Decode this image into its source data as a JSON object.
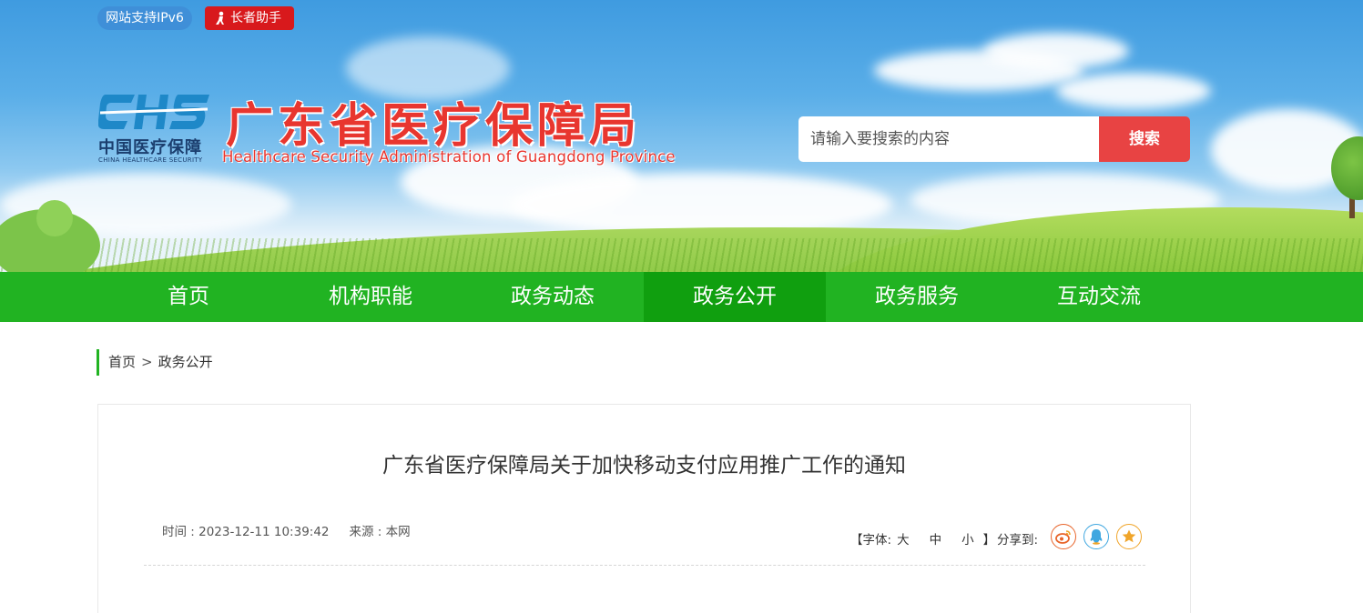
{
  "top_bar": {
    "ipv6_label": "网站支持IPv6",
    "elder_label": "长者助手"
  },
  "logo": {
    "mark_text": "CHS",
    "cn_text": "中国医疗保障",
    "en_text": "CHINA HEALTHCARE SECURITY"
  },
  "header": {
    "title": "广东省医疗保障局",
    "subtitle": "Healthcare Security Administration of Guangdong Province"
  },
  "search": {
    "placeholder": "请输入要搜索的内容",
    "button_label": "搜索"
  },
  "nav": {
    "items": [
      {
        "label": "首页"
      },
      {
        "label": "机构职能"
      },
      {
        "label": "政务动态"
      },
      {
        "label": "政务公开"
      },
      {
        "label": "政务服务"
      },
      {
        "label": "互动交流"
      }
    ],
    "active_index": 3
  },
  "breadcrumb": {
    "home": "首页",
    "separator": ">",
    "current": "政务公开"
  },
  "article": {
    "title": "广东省医疗保障局关于加快移动支付应用推广工作的通知",
    "time": "时间 : 2023-12-11 10:39:42",
    "source": "来源 : 本网",
    "font_size_open": "【字体:",
    "font_sizes": [
      "大",
      "中",
      "小"
    ],
    "font_size_close": "】",
    "share_label": "分享到:",
    "share_icons": [
      "weibo-icon",
      "qq-icon",
      "favorite-icon"
    ]
  },
  "colors": {
    "nav_green": "#21b322",
    "nav_active": "#109f0f",
    "title_red": "#e8362f",
    "search_button": "#e84343"
  }
}
